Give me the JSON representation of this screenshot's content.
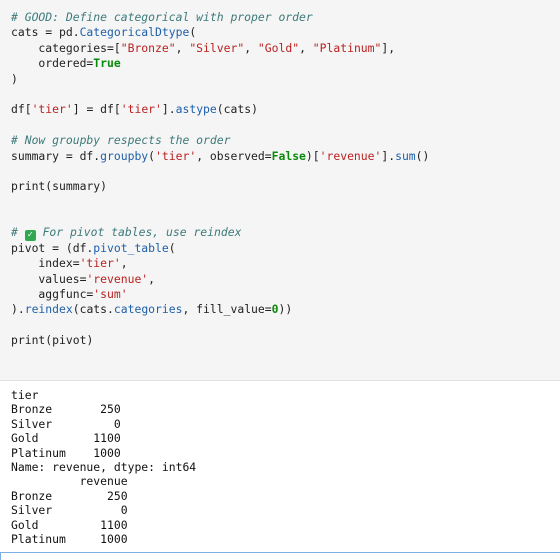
{
  "cell": {
    "code_lines": [
      [
        {
          "t": "# GOOD: Define categorical with proper order",
          "c": "comment"
        }
      ],
      [
        {
          "t": "cats = pd.",
          "c": ""
        },
        {
          "t": "CategoricalDtype",
          "c": "fn"
        },
        {
          "t": "(",
          "c": ""
        }
      ],
      [
        {
          "t": "    categories=",
          "c": ""
        },
        {
          "t": "[",
          "c": ""
        },
        {
          "t": "\"Bronze\"",
          "c": "str"
        },
        {
          "t": ", ",
          "c": ""
        },
        {
          "t": "\"Silver\"",
          "c": "str"
        },
        {
          "t": ", ",
          "c": ""
        },
        {
          "t": "\"Gold\"",
          "c": "str"
        },
        {
          "t": ", ",
          "c": ""
        },
        {
          "t": "\"Platinum\"",
          "c": "str"
        },
        {
          "t": "],",
          "c": ""
        }
      ],
      [
        {
          "t": "    ordered=",
          "c": ""
        },
        {
          "t": "True",
          "c": "kw"
        }
      ],
      [
        {
          "t": ")",
          "c": ""
        }
      ],
      [],
      [
        {
          "t": "df[",
          "c": ""
        },
        {
          "t": "'tier'",
          "c": "str"
        },
        {
          "t": "] = df[",
          "c": ""
        },
        {
          "t": "'tier'",
          "c": "str"
        },
        {
          "t": "].",
          "c": ""
        },
        {
          "t": "astype",
          "c": "fn"
        },
        {
          "t": "(cats)",
          "c": ""
        }
      ],
      [],
      [
        {
          "t": "# Now groupby respects the order",
          "c": "comment"
        }
      ],
      [
        {
          "t": "summary = df.",
          "c": ""
        },
        {
          "t": "groupby",
          "c": "fn"
        },
        {
          "t": "(",
          "c": ""
        },
        {
          "t": "'tier'",
          "c": "str"
        },
        {
          "t": ", observed=",
          "c": ""
        },
        {
          "t": "False",
          "c": "kw"
        },
        {
          "t": ")[",
          "c": ""
        },
        {
          "t": "'revenue'",
          "c": "str"
        },
        {
          "t": "].",
          "c": ""
        },
        {
          "t": "sum",
          "c": "fn"
        },
        {
          "t": "()",
          "c": ""
        }
      ],
      [],
      [
        {
          "t": "print",
          "c": ""
        },
        {
          "t": "(summary)",
          "c": ""
        }
      ],
      [],
      [],
      [
        {
          "t": "# ",
          "c": "comment"
        },
        {
          "t": "check",
          "c": "icon"
        },
        {
          "t": " For pivot tables, use reindex",
          "c": "comment"
        }
      ],
      [
        {
          "t": "pivot = (df.",
          "c": ""
        },
        {
          "t": "pivot_table",
          "c": "fn"
        },
        {
          "t": "(",
          "c": ""
        }
      ],
      [
        {
          "t": "    index=",
          "c": ""
        },
        {
          "t": "'tier'",
          "c": "str"
        },
        {
          "t": ",",
          "c": ""
        }
      ],
      [
        {
          "t": "    values=",
          "c": ""
        },
        {
          "t": "'revenue'",
          "c": "str"
        },
        {
          "t": ",",
          "c": ""
        }
      ],
      [
        {
          "t": "    aggfunc=",
          "c": ""
        },
        {
          "t": "'sum'",
          "c": "str"
        }
      ],
      [
        {
          "t": ").",
          "c": ""
        },
        {
          "t": "reindex",
          "c": "fn"
        },
        {
          "t": "(cats.",
          "c": ""
        },
        {
          "t": "categories",
          "c": "fn"
        },
        {
          "t": ", fill_value=",
          "c": ""
        },
        {
          "t": "0",
          "c": "kw"
        },
        {
          "t": "))",
          "c": ""
        }
      ],
      [],
      [
        {
          "t": "print",
          "c": ""
        },
        {
          "t": "(pivot)",
          "c": ""
        }
      ]
    ],
    "check_icon_name": "check-mark-icon",
    "check_icon_color": "#2fa84f"
  },
  "output": {
    "lines": [
      "tier",
      "Bronze       250",
      "Silver         0",
      "Gold        1100",
      "Platinum    1000",
      "Name: revenue, dtype: int64",
      "          revenue",
      "Bronze        250",
      "Silver          0",
      "Gold         1100",
      "Platinum     1000"
    ]
  }
}
